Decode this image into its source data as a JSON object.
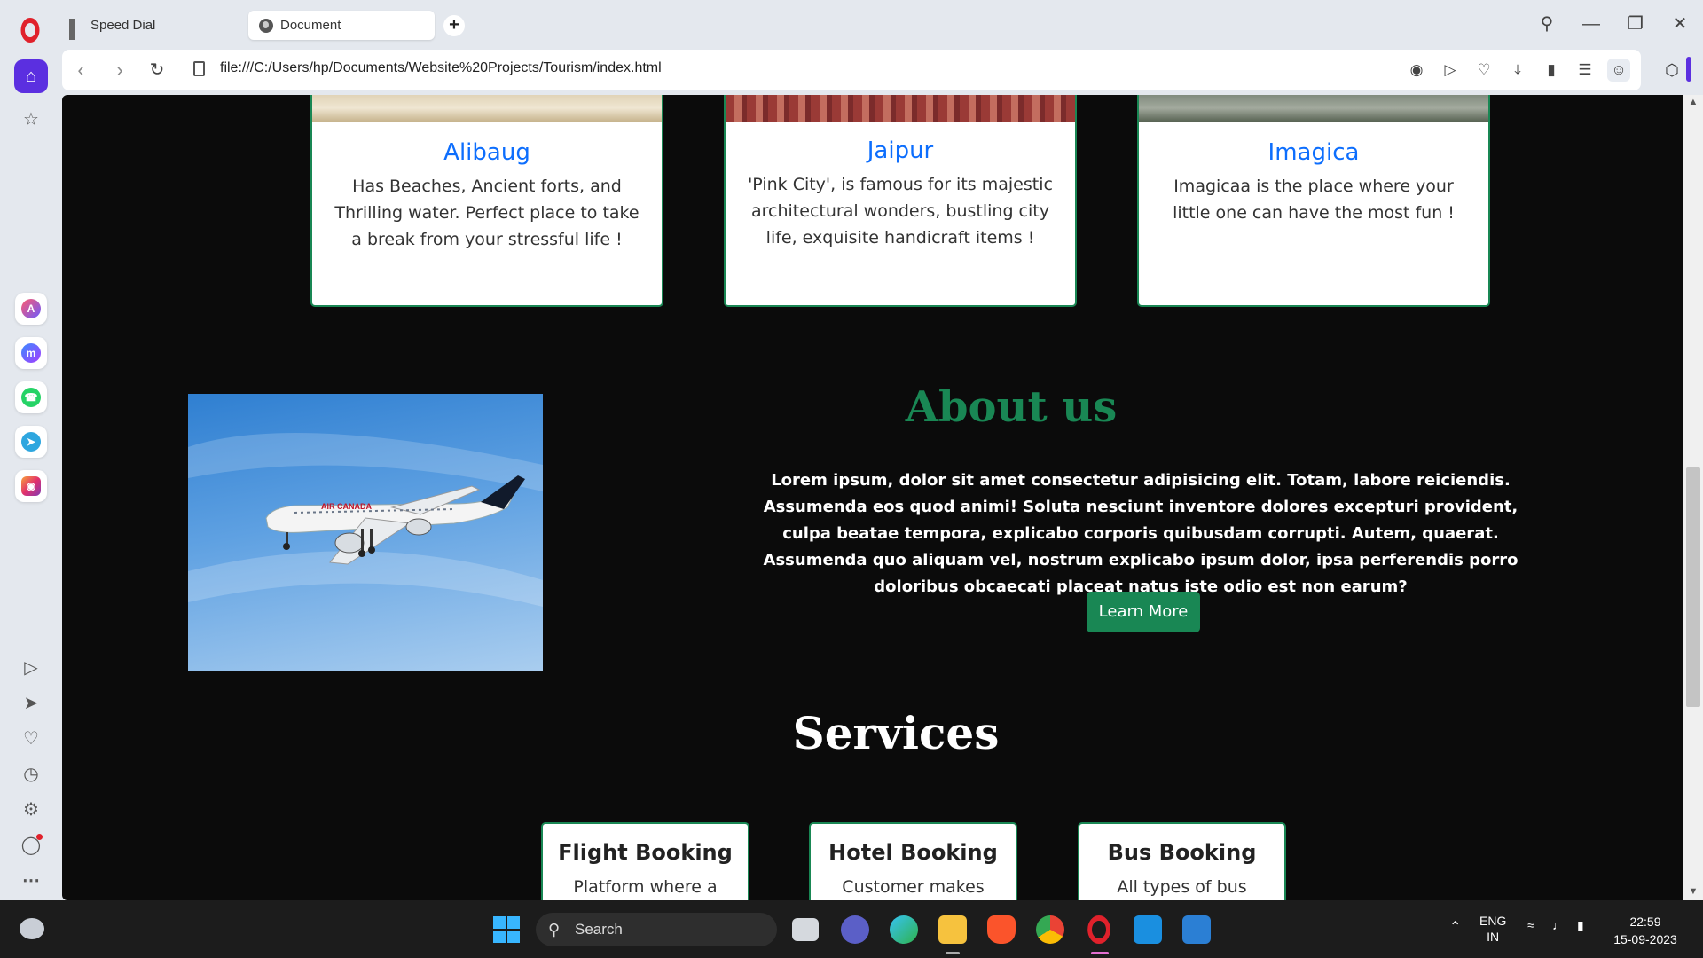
{
  "browser": {
    "tabs": [
      {
        "label": "Speed Dial",
        "active": false
      },
      {
        "label": "Document",
        "active": true
      }
    ],
    "url": "file:///C:/Users/hp/Documents/Website%20Projects/Tourism/index.html"
  },
  "destinations": [
    {
      "name": "Alibaug",
      "text": "Has Beaches, Ancient forts, and Thrilling water. Perfect place to take a break from your stressful life !"
    },
    {
      "name": "Jaipur",
      "text": "'Pink City', is famous for its majestic architectural wonders, bustling city life, exquisite handicraft items !"
    },
    {
      "name": "Imagica",
      "text": "Imagicaa is the place where your little one can have the most fun !"
    }
  ],
  "about": {
    "title": "About us",
    "text": "Lorem ipsum, dolor sit amet consectetur adipisicing elit. Totam, labore reiciendis. Assumenda eos quod animi! Soluta nesciunt inventore dolores excepturi provident, culpa beatae tempora, explicabo corporis quibusdam corrupti. Autem, quaerat. Assumenda quo aliquam vel, nostrum explicabo ipsum dolor, ipsa perferendis porro doloribus obcaecati placeat natus iste odio est non earum?",
    "button": "Learn More",
    "image_text": "AIR CANADA"
  },
  "services": {
    "title": "Services",
    "items": [
      {
        "title": "Flight Booking",
        "text": "Platform where a"
      },
      {
        "title": "Hotel Booking",
        "text": "Customer makes"
      },
      {
        "title": "Bus Booking",
        "text": "All types of bus"
      }
    ]
  },
  "taskbar": {
    "search_label": "Search",
    "language": "ENG",
    "region": "IN",
    "time": "22:59",
    "date": "15-09-2023"
  },
  "colors": {
    "accent_green": "#198754",
    "link_blue": "#0d6efd",
    "opera_red": "#e0212b",
    "opera_purple": "#5b2fe0"
  }
}
